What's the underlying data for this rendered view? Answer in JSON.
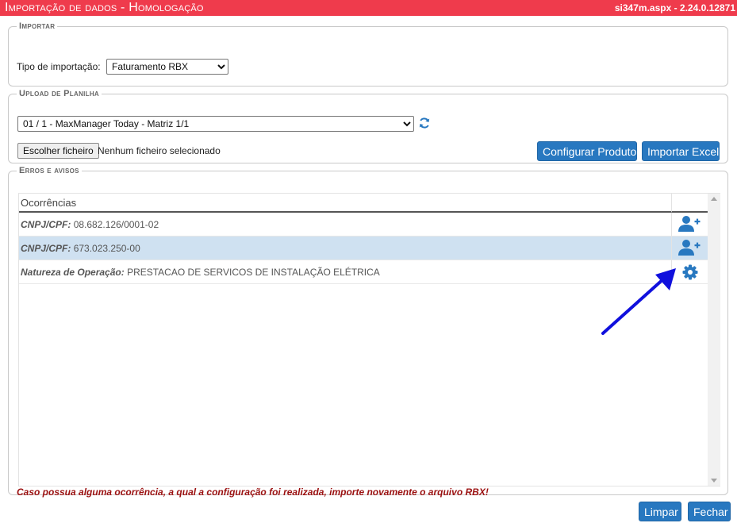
{
  "header": {
    "title": "Importação de dados  - Homologação",
    "version": "si347m.aspx - 2.24.0.12871",
    "bg_color": "#ef3b4c"
  },
  "importar": {
    "legend": "Importar",
    "tipo_label": "Tipo de importação:",
    "tipo_value": "Faturamento RBX"
  },
  "upload": {
    "legend": "Upload de Planilha",
    "planilha_value": "01 / 1 - MaxManager Today - Matriz 1/1",
    "refresh_icon": "refresh-icon",
    "file_button": "Escolher ficheiro",
    "file_status": "Nenhum ficheiro selecionado",
    "configurar_button": "Configurar Produto",
    "importar_button": "Importar Excel"
  },
  "erros": {
    "legend": "Erros e avisos",
    "column_header": "Ocorrências",
    "rows": [
      {
        "label": "CNPJ/CPF:",
        "value": "08.682.126/0001-02",
        "icon": "add-user-icon",
        "selected": false
      },
      {
        "label": "CNPJ/CPF:",
        "value": "673.023.250-00",
        "icon": "add-user-icon",
        "selected": true
      },
      {
        "label": "Natureza de Operação:",
        "value": "PRESTACAO DE SERVICOS DE INSTALAÇÃO ELÉTRICA",
        "icon": "gear-icon",
        "selected": false
      }
    ],
    "warning": "Caso possua alguma ocorrência, a qual a configuração foi realizada, importe novamente o arquivo RBX!"
  },
  "footer": {
    "limpar_button": "Limpar",
    "fechar_button": "Fechar"
  },
  "colors": {
    "accent_button": "#2878c0",
    "icon_blue": "#2878c0",
    "selected_row": "#cfe1f1",
    "warning_text": "#9b1010",
    "annotation_arrow": "#1010dd"
  }
}
